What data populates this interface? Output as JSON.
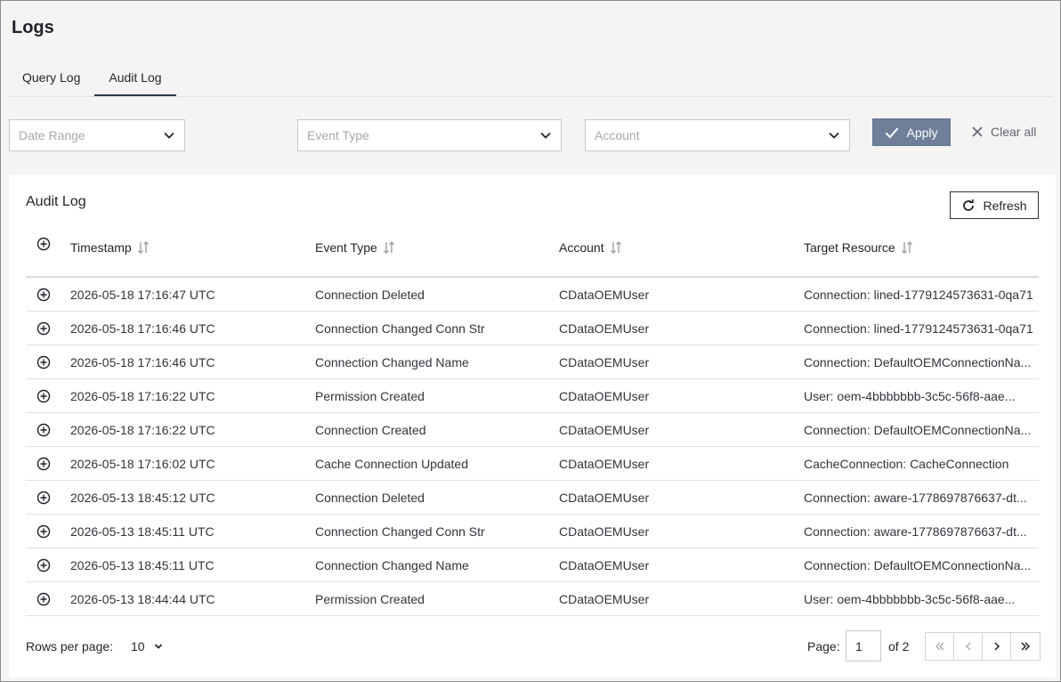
{
  "page": {
    "title": "Logs"
  },
  "tabs": [
    {
      "label": "Query Log",
      "active": false
    },
    {
      "label": "Audit Log",
      "active": true
    }
  ],
  "filters": {
    "date_range": {
      "placeholder": "Date Range"
    },
    "event_type": {
      "placeholder": "Event Type"
    },
    "account": {
      "placeholder": "Account"
    },
    "apply_label": "Apply",
    "clear_label": "Clear all"
  },
  "card": {
    "title": "Audit Log",
    "refresh_label": "Refresh"
  },
  "table": {
    "columns": [
      "Timestamp",
      "Event Type",
      "Account",
      "Target Resource"
    ],
    "rows": [
      [
        "2026-05-18 17:16:47 UTC",
        "Connection Deleted",
        "CDataOEMUser",
        "Connection: lined-1779124573631-0qa71"
      ],
      [
        "2026-05-18 17:16:46 UTC",
        "Connection Changed Conn Str",
        "CDataOEMUser",
        "Connection: lined-1779124573631-0qa71"
      ],
      [
        "2026-05-18 17:16:46 UTC",
        "Connection Changed Name",
        "CDataOEMUser",
        "Connection: DefaultOEMConnectionNa..."
      ],
      [
        "2026-05-18 17:16:22 UTC",
        "Permission Created",
        "CDataOEMUser",
        "User: oem-4bbbbbbb-3c5c-56f8-aae..."
      ],
      [
        "2026-05-18 17:16:22 UTC",
        "Connection Created",
        "CDataOEMUser",
        "Connection: DefaultOEMConnectionNa..."
      ],
      [
        "2026-05-18 17:16:02 UTC",
        "Cache Connection Updated",
        "CDataOEMUser",
        "CacheConnection: CacheConnection"
      ],
      [
        "2026-05-13 18:45:12 UTC",
        "Connection Deleted",
        "CDataOEMUser",
        "Connection: aware-1778697876637-dt..."
      ],
      [
        "2026-05-13 18:45:11 UTC",
        "Connection Changed Conn Str",
        "CDataOEMUser",
        "Connection: aware-1778697876637-dt..."
      ],
      [
        "2026-05-13 18:45:11 UTC",
        "Connection Changed Name",
        "CDataOEMUser",
        "Connection: DefaultOEMConnectionNa..."
      ],
      [
        "2026-05-13 18:44:44 UTC",
        "Permission Created",
        "CDataOEMUser",
        "User: oem-4bbbbbbb-3c5c-56f8-aae..."
      ]
    ]
  },
  "pagination": {
    "rows_per_page_label": "Rows per page:",
    "rows_per_page_value": "10",
    "page_label": "Page:",
    "current_page": "1",
    "of_label": "of 2"
  },
  "colors": {
    "apply_bg": "#6f7f99",
    "active_tab_underline": "#2b3a4a",
    "page_bg": "#f5f4f3"
  }
}
